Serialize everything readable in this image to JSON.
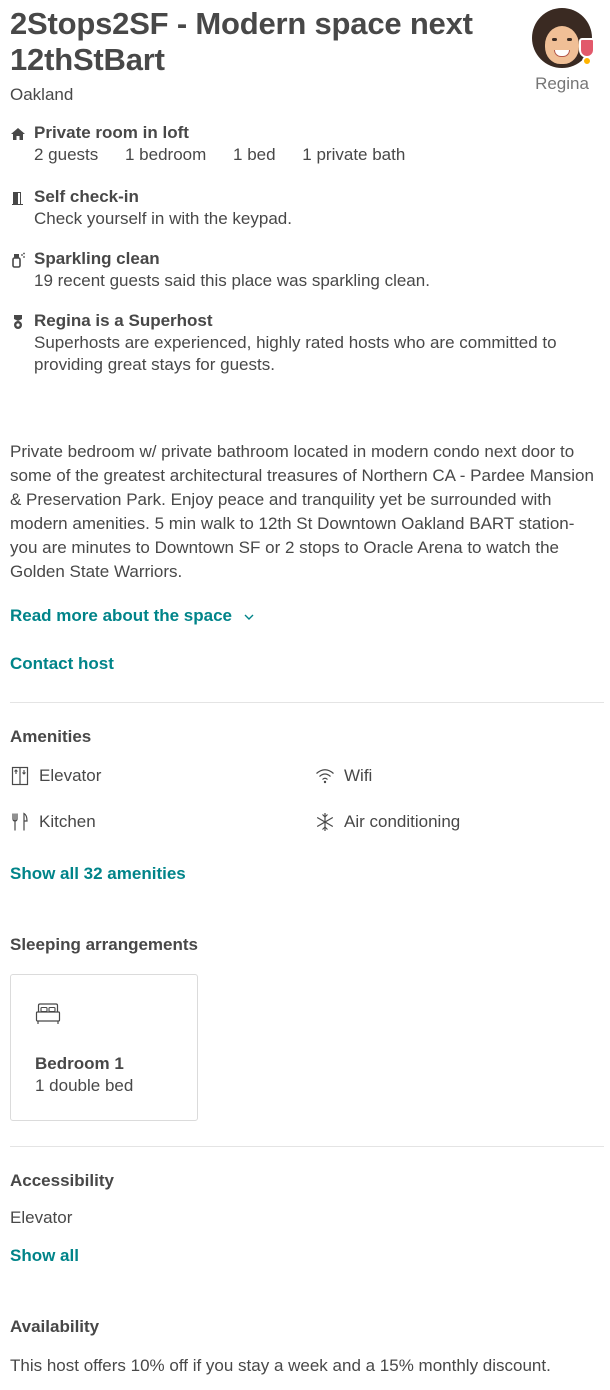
{
  "listing": {
    "title": "2Stops2SF - Modern space next 12thStBart",
    "city": "Oakland"
  },
  "host": {
    "name": "Regina",
    "avatar_icon": "host-avatar",
    "badge_icon": "superhost-badge-icon"
  },
  "highlights": {
    "room": {
      "icon": "home-icon",
      "title": "Private room in loft",
      "facts": [
        "2 guests",
        "1 bedroom",
        "1 bed",
        "1 private bath"
      ]
    },
    "checkin": {
      "icon": "door-icon",
      "title": "Self check-in",
      "desc": "Check yourself in with the keypad."
    },
    "clean": {
      "icon": "spray-bottle-icon",
      "title": "Sparkling clean",
      "desc": "19 recent guests said this place was sparkling clean."
    },
    "superhost": {
      "icon": "medal-icon",
      "title": "Regina is a Superhost",
      "desc": "Superhosts are experienced, highly rated hosts who are committed to providing great stays for guests."
    }
  },
  "description": "Private bedroom w/ private bathroom located in modern condo next door to some of the greatest architectural treasures of Northern CA - Pardee Mansion & Preservation Park. Enjoy peace and tranquility yet be surrounded with modern amenities. 5 min walk to 12th St Downtown Oakland BART station-you are minutes to Downtown SF or 2 stops to Oracle Arena to watch the Golden State Warriors.",
  "links": {
    "read_more": "Read more about the space",
    "contact_host": "Contact host"
  },
  "amenities": {
    "title": "Amenities",
    "items": [
      {
        "label": "Elevator",
        "icon": "elevator-icon"
      },
      {
        "label": "Wifi",
        "icon": "wifi-icon"
      },
      {
        "label": "Kitchen",
        "icon": "utensils-icon"
      },
      {
        "label": "Air conditioning",
        "icon": "snowflake-icon"
      }
    ],
    "show_all": "Show all 32 amenities"
  },
  "sleeping": {
    "title": "Sleeping arrangements",
    "bedrooms": [
      {
        "name": "Bedroom 1",
        "beds": "1 double bed",
        "icon": "bed-icon"
      }
    ]
  },
  "accessibility": {
    "title": "Accessibility",
    "items": [
      "Elevator"
    ],
    "show_all": "Show all"
  },
  "availability": {
    "title": "Availability",
    "text": "This host offers 10% off if you stay a week and a 15% monthly discount."
  },
  "colors": {
    "text": "#484848",
    "link": "#008489",
    "muted": "#767676",
    "divider": "#e4e4e4"
  }
}
